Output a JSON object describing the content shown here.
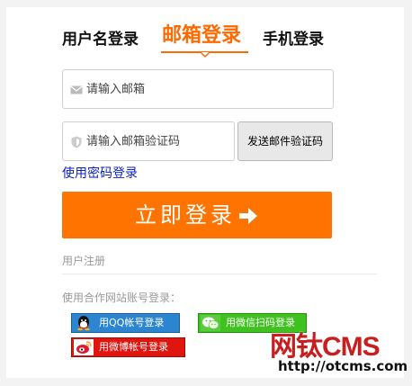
{
  "tabs": {
    "username": "用户名登录",
    "email": "邮箱登录",
    "phone": "手机登录",
    "active": "email"
  },
  "form": {
    "email_placeholder": "请输入邮箱",
    "code_placeholder": "请输入邮箱验证码",
    "send_code_label": "发送邮件验证码",
    "password_login_link": "使用密码登录",
    "login_button": "立即登录"
  },
  "register_link": "用户注册",
  "partner": {
    "title": "使用合作网站账号登录：",
    "qq": "用QQ帐号登录",
    "wechat": "用微信扫码登录",
    "weibo": "用微博帐号登录"
  },
  "watermark": {
    "logo": "网钛CMS",
    "url": "http://otcms.com"
  },
  "colors": {
    "accent": "#ff6a00",
    "login_button": "#ff7300",
    "link": "#0a1fc7",
    "qq": "#2c85d0",
    "wechat": "#3fc21f",
    "weibo": "#e0150f"
  }
}
